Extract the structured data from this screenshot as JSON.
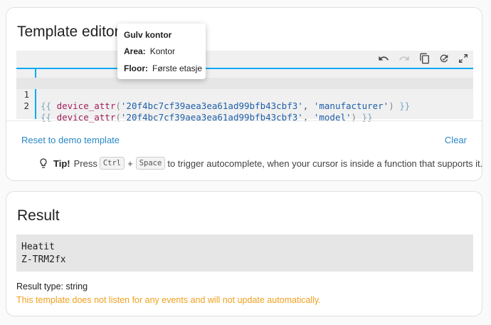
{
  "editor": {
    "title": "Template editor",
    "toolbar": {
      "undo_icon": "undo-icon",
      "redo_icon": "redo-icon",
      "copy_icon": "copy-icon",
      "format_icon": "format-icon",
      "fullscreen_icon": "fullscreen-icon"
    },
    "lines": [
      {
        "number": "1",
        "open": "{{ ",
        "fn": "device_attr",
        "arg1": "'20f4bc7cf39aea3ea61ad99bfb43cbf3'",
        "arg2": "'manufacturer'",
        "close": " }}"
      },
      {
        "number": "2",
        "open": "{{ ",
        "fn": "device_attr",
        "arg1": "'20f4bc7cf39aea3ea61ad99bfb43cbf3'",
        "arg2": "'model'",
        "close": " }}"
      }
    ],
    "reset_label": "Reset to demo template",
    "clear_label": "Clear",
    "tip": {
      "bold": "Tip!",
      "press": "Press",
      "key1": "Ctrl",
      "plus": "+",
      "key2": "Space",
      "rest": "to trigger autocomplete, when your cursor is inside a function that supports it."
    }
  },
  "tooltip": {
    "title": "Gulv kontor",
    "area_label": "Area:",
    "area_value": "Kontor",
    "floor_label": "Floor:",
    "floor_value": "Første etasje"
  },
  "result": {
    "title": "Result",
    "output_lines": [
      "Heatit",
      "Z-TRM2fx"
    ],
    "type_text": "Result type: string",
    "warning": "This template does not listen for any events and will not update automatically.",
    "colors": {
      "warning": "#f0a020",
      "link": "#2a87c6",
      "accent": "#03a9f4"
    }
  }
}
